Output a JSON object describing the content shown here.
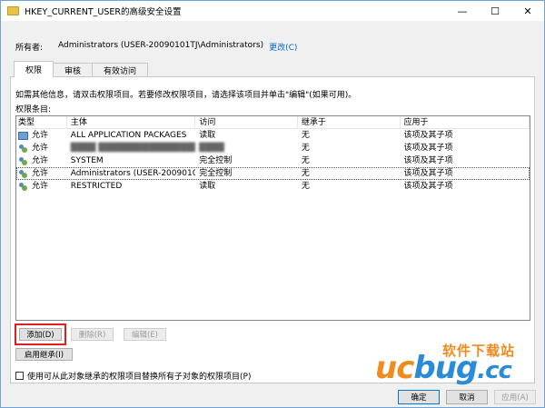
{
  "window": {
    "title": "HKEY_CURRENT_USER的高级安全设置",
    "minimize": "—",
    "maximize": "☐",
    "close": "✕"
  },
  "owner": {
    "label": "所有者:",
    "value": "Administrators (USER-20090101TJ\\Administrators)",
    "change_link": "更改(C)"
  },
  "tabs": [
    {
      "label": "权限",
      "active": true
    },
    {
      "label": "审核",
      "active": false
    },
    {
      "label": "有效访问",
      "active": false
    }
  ],
  "permissions": {
    "hint": "如需其他信息，请双击权限项目。若要修改权限项目，请选择该项目并单击\"编辑\"(如果可用)。",
    "list_label": "权限条目:",
    "columns": [
      "类型",
      "主体",
      "访问",
      "继承于",
      "应用于"
    ],
    "rows": [
      {
        "icon": "package-icon",
        "type": "允许",
        "principal": "ALL APPLICATION PACKAGES",
        "access": "读取",
        "inherit": "无",
        "apply": "该项及其子项",
        "blurred": false,
        "selected": false
      },
      {
        "icon": "user-group-icon",
        "type": "允许",
        "principal": "████ ████████████████",
        "access": "████",
        "inherit": "无",
        "apply": "该项及其子项",
        "blurred": true,
        "selected": false
      },
      {
        "icon": "user-group-icon",
        "type": "允许",
        "principal": "SYSTEM",
        "access": "完全控制",
        "inherit": "无",
        "apply": "该项及其子项",
        "blurred": false,
        "selected": false
      },
      {
        "icon": "user-group-icon",
        "type": "允许",
        "principal": "Administrators (USER-20090101...",
        "access": "完全控制",
        "inherit": "无",
        "apply": "该项及其子项",
        "blurred": false,
        "selected": true
      },
      {
        "icon": "user-group-icon",
        "type": "允许",
        "principal": "RESTRICTED",
        "access": "读取",
        "inherit": "无",
        "apply": "该项及其子项",
        "blurred": false,
        "selected": false
      }
    ]
  },
  "actions": {
    "add": "添加(D)",
    "remove": "删除(R)",
    "edit": "编辑(E)",
    "enable_inheritance": "启用继承(I)",
    "replace_checkbox": "使用可从此对象继承的权限项目替换所有子对象的权限项目(P)"
  },
  "footer": {
    "ok": "确定",
    "cancel": "取消",
    "apply": "应用(A)"
  },
  "watermark": {
    "text": "软件下载站",
    "logo_uc": "uc",
    "logo_bug": "bug",
    "logo_cc": ".cc"
  },
  "colors": {
    "accent": "#0078d7",
    "link": "#0066cc",
    "highlight": "#e02020",
    "watermark_orange": "#f28a1f",
    "watermark_blue": "#2a8bd8"
  }
}
